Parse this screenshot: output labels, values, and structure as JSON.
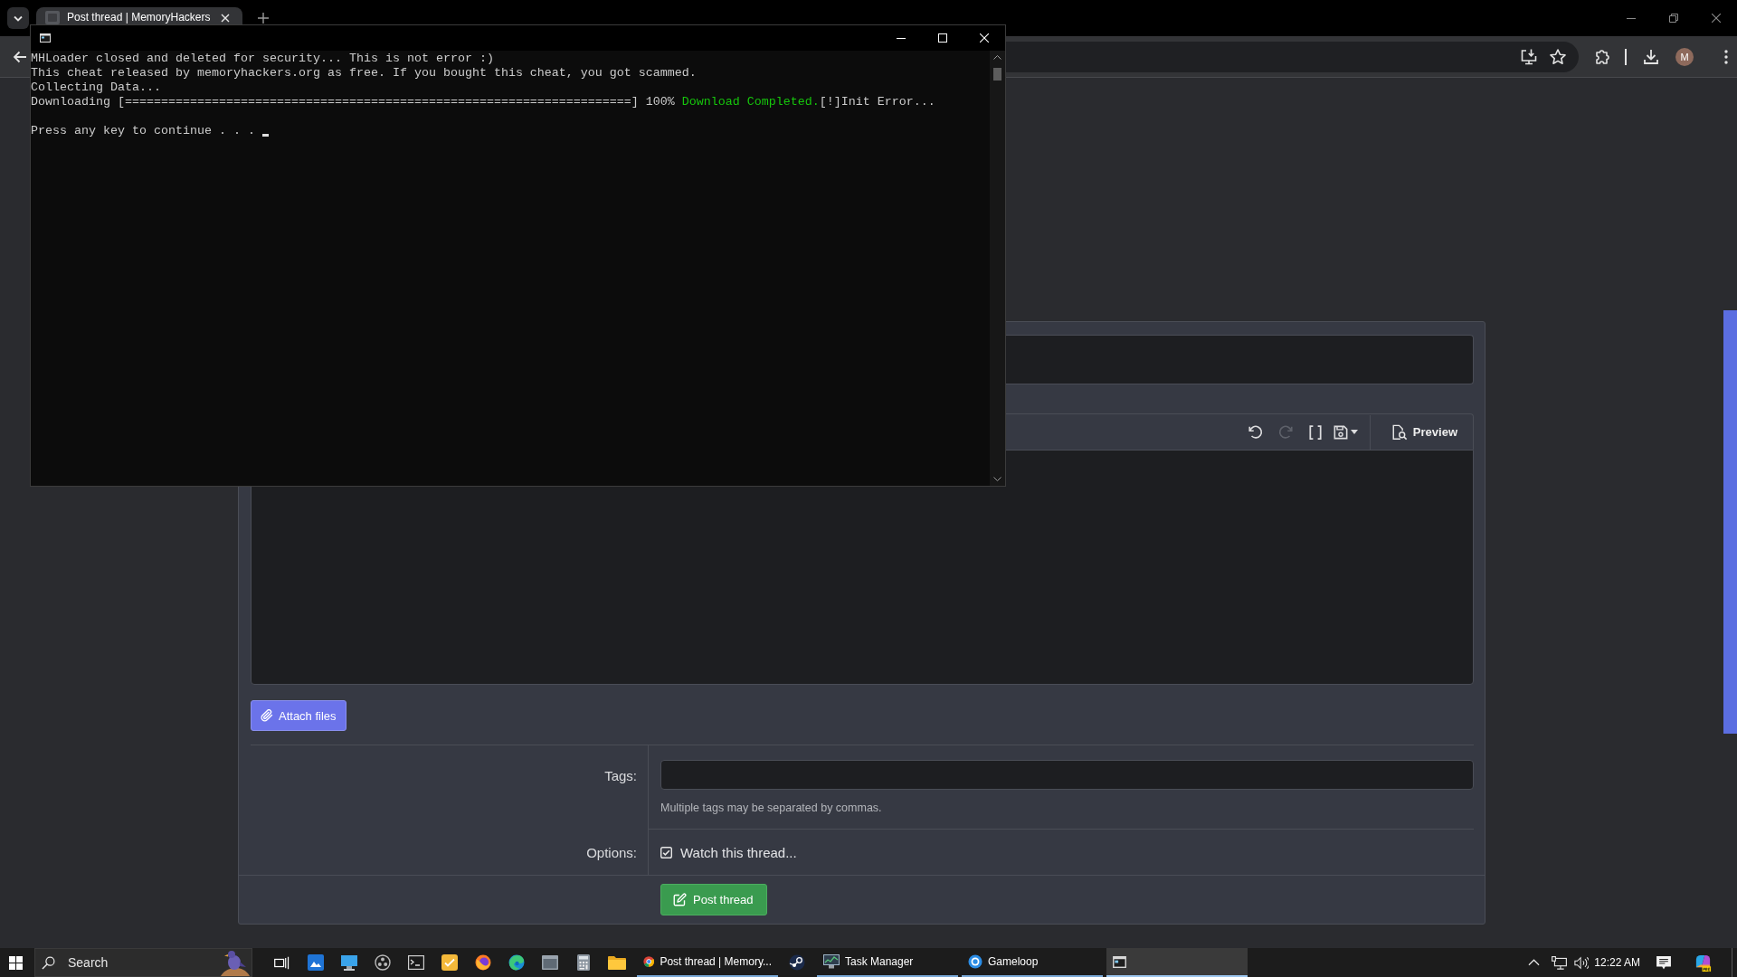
{
  "browser": {
    "tabs": [
      {
        "title": "Post thread | MemoryHackers",
        "selected": true
      }
    ],
    "profile_initial": "M"
  },
  "console_window": {
    "output": [
      {
        "segments": [
          {
            "kind": "plain",
            "text": "MHLoader closed and deleted for security... This is not error :)"
          }
        ]
      },
      {
        "segments": [
          {
            "kind": "plain",
            "text": "This cheat released by memoryhackers.org as free. If you bought this cheat, you got scammed."
          }
        ]
      },
      {
        "segments": [
          {
            "kind": "plain",
            "text": "Collecting Data..."
          }
        ]
      },
      {
        "segments": [
          {
            "kind": "plain",
            "text": "Downloading [======================================================================] 100% "
          },
          {
            "kind": "success",
            "text": "Download Completed."
          },
          {
            "kind": "plain",
            "text": "[!]Init Error..."
          }
        ]
      }
    ],
    "prompt": "Press any key to continue . . .",
    "cursor": true
  },
  "form": {
    "editor": {
      "tools": [
        {
          "kind": "undo",
          "disabled": false
        },
        {
          "kind": "redo",
          "disabled": true
        },
        {
          "kind": "source",
          "disabled": false
        },
        {
          "kind": "drafts",
          "disabled": false
        }
      ],
      "preview_label": "Preview"
    },
    "attach_label": "Attach files",
    "tags": {
      "label": "Tags:",
      "hint": "Multiple tags may be separated by commas."
    },
    "options": {
      "label": "Options:",
      "watch": {
        "label": "Watch this thread...",
        "checked": true
      }
    },
    "submit_label": "Post thread"
  },
  "taskbar": {
    "search": {
      "placeholder": "Search"
    },
    "windows": [
      {
        "kind": "browser",
        "label": "Post thread | Memory...",
        "selected": false,
        "running": true
      },
      {
        "kind": "game-client",
        "selected": false,
        "running": false
      },
      {
        "kind": "task-manager",
        "label": "Task Manager",
        "selected": false,
        "running": true
      },
      {
        "kind": "emulator",
        "label": "Gameloop",
        "selected": false,
        "running": true
      },
      {
        "kind": "console",
        "selected": true,
        "running": true
      }
    ],
    "clock": "12:22 AM"
  }
}
